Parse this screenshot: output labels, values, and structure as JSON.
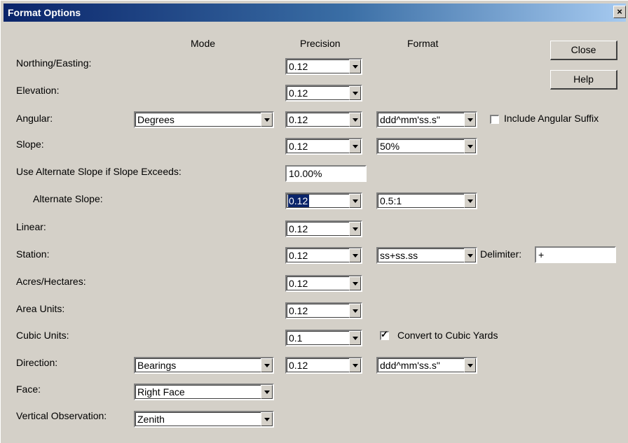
{
  "window": {
    "title": "Format Options",
    "close_glyph": "×"
  },
  "headers": {
    "mode": "Mode",
    "precision": "Precision",
    "format": "Format"
  },
  "buttons": {
    "close": "Close",
    "help": "Help"
  },
  "rows": {
    "northing_easting": {
      "label": "Northing/Easting:",
      "precision": "0.12"
    },
    "elevation": {
      "label": "Elevation:",
      "precision": "0.12"
    },
    "angular": {
      "label": "Angular:",
      "mode": "Degrees",
      "precision": "0.12",
      "format": "ddd^mm'ss.s\"",
      "suffix_label": "Include Angular Suffix",
      "suffix_checked": false
    },
    "slope": {
      "label": "Slope:",
      "precision": "0.12",
      "format": "50%"
    },
    "alt_slope_exceeds": {
      "label": "Use Alternate Slope if Slope Exceeds:",
      "value": "10.00%"
    },
    "alternate_slope": {
      "label": "Alternate Slope:",
      "precision": "0.12",
      "format": "0.5:1"
    },
    "linear": {
      "label": "Linear:",
      "precision": "0.12"
    },
    "station": {
      "label": "Station:",
      "precision": "0.12",
      "format": "ss+ss.ss",
      "delimiter_label": "Delimiter:",
      "delimiter": "+"
    },
    "acres_hectares": {
      "label": "Acres/Hectares:",
      "precision": "0.12"
    },
    "area_units": {
      "label": "Area Units:",
      "precision": "0.12"
    },
    "cubic_units": {
      "label": "Cubic Units:",
      "precision": "0.1",
      "convert_label": "Convert to Cubic Yards",
      "convert_checked": true
    },
    "direction": {
      "label": "Direction:",
      "mode": "Bearings",
      "precision": "0.12",
      "format": "ddd^mm'ss.s\""
    },
    "face": {
      "label": "Face:",
      "mode": "Right Face"
    },
    "vertical_observation": {
      "label": "Vertical Observation:",
      "mode": "Zenith"
    }
  },
  "colors": {
    "titlebar_start": "#0a246a",
    "titlebar_end": "#a6caf0",
    "dialog_bg": "#d4d0c8",
    "selection": "#0a246a"
  }
}
